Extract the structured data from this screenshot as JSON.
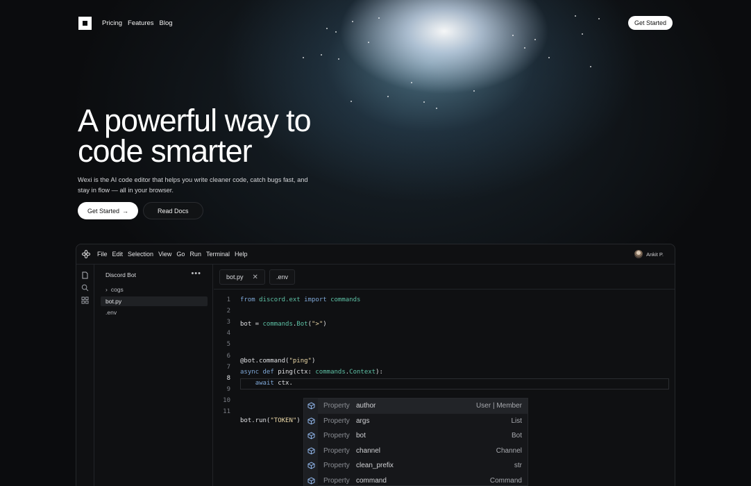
{
  "nav": {
    "links": [
      "Pricing",
      "Features",
      "Blog"
    ],
    "cta": "Get Started"
  },
  "hero": {
    "title_line1": "A powerful way to",
    "title_line2": "code smarter",
    "subtitle": "Wexi is the AI code editor that helps you write cleaner code, catch bugs fast, and stay in flow — all in your browser.",
    "primary_cta": "Get Started",
    "primary_arrow": "→",
    "secondary_cta": "Read Docs"
  },
  "editor": {
    "menus": [
      "File",
      "Edit",
      "Selection",
      "View",
      "Go",
      "Run",
      "Terminal",
      "Help"
    ],
    "user": "Ankit P.",
    "sidebar": {
      "title": "Discord Bot",
      "more": "•••",
      "items": [
        {
          "label": "cogs",
          "chevron": "›"
        },
        {
          "label": "bot.py"
        },
        {
          "label": ".env"
        }
      ]
    },
    "tabs": [
      {
        "label": "bot.py",
        "close": "✕"
      },
      {
        "label": ".env"
      }
    ],
    "line_numbers": [
      "1",
      "2",
      "3",
      "4",
      "5",
      "6",
      "7",
      "8",
      "9",
      "10",
      "11"
    ],
    "current_line": "8",
    "autocomplete": [
      {
        "kind": "Property",
        "name": "author",
        "type": "User | Member"
      },
      {
        "kind": "Property",
        "name": "args",
        "type": "List"
      },
      {
        "kind": "Property",
        "name": "bot",
        "type": "Bot"
      },
      {
        "kind": "Property",
        "name": "channel",
        "type": "Channel"
      },
      {
        "kind": "Property",
        "name": "clean_prefix",
        "type": "str"
      },
      {
        "kind": "Property",
        "name": "command",
        "type": "Command"
      }
    ]
  },
  "colors": {
    "background": "#0b0c0e",
    "keyword": "#7fa8d8",
    "module": "#5ec2a6",
    "string": "#ecd9a8",
    "autocomplete_icon": "#8fb4e8"
  }
}
